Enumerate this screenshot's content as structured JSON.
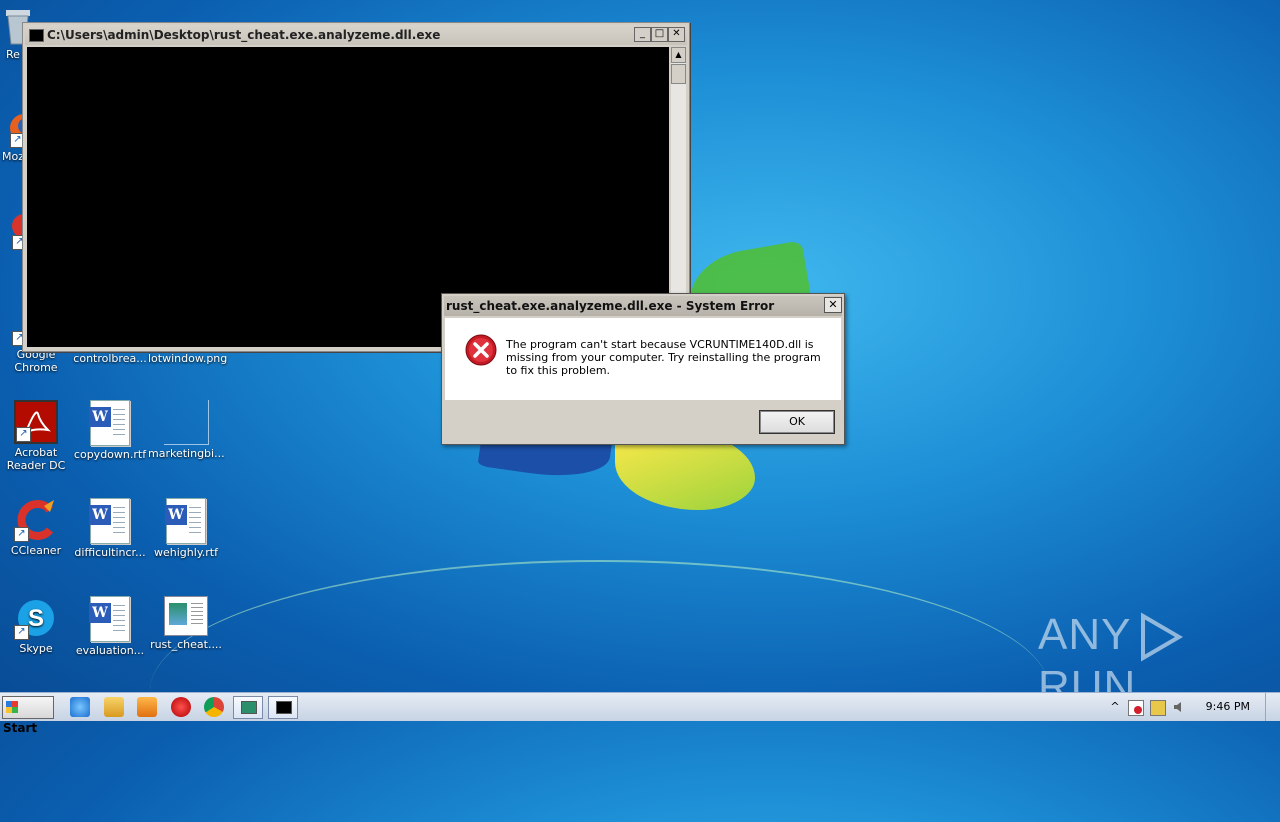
{
  "desktop_icons": {
    "recycle": "Re",
    "mozilla": "Moz",
    "chrome": "Google Chrome",
    "controlbreak": "controlbrea...",
    "lotwindow": "lotwindow.png",
    "acrobat": "Acrobat Reader DC",
    "copydown": "copydown.rtf",
    "marketing": "marketingbi...",
    "ccleaner": "CCleaner",
    "difficult": "difficultincr...",
    "wehighly": "wehighly.rtf",
    "skype": "Skype",
    "evaluation": "evaluation...",
    "rustcheat": "rust_cheat...."
  },
  "console": {
    "title": "C:\\Users\\admin\\Desktop\\rust_cheat.exe.analyzeme.dll.exe",
    "min": "_",
    "max": "□",
    "close": "✕",
    "up": "▲"
  },
  "dialog": {
    "title": "rust_cheat.exe.analyzeme.dll.exe - System Error",
    "close": "✕",
    "message": "The program can't start because VCRUNTIME140D.dll is missing from your computer. Try reinstalling the program to fix this problem.",
    "ok": "OK"
  },
  "watermark": {
    "left": "ANY",
    "right": "RUN"
  },
  "taskbar": {
    "start": "Start",
    "clock": "9:46 PM",
    "tray_arrow": "^"
  },
  "colors": {
    "error_red": "#d21f2b",
    "titlebar_gray": "#c8c4bc"
  }
}
